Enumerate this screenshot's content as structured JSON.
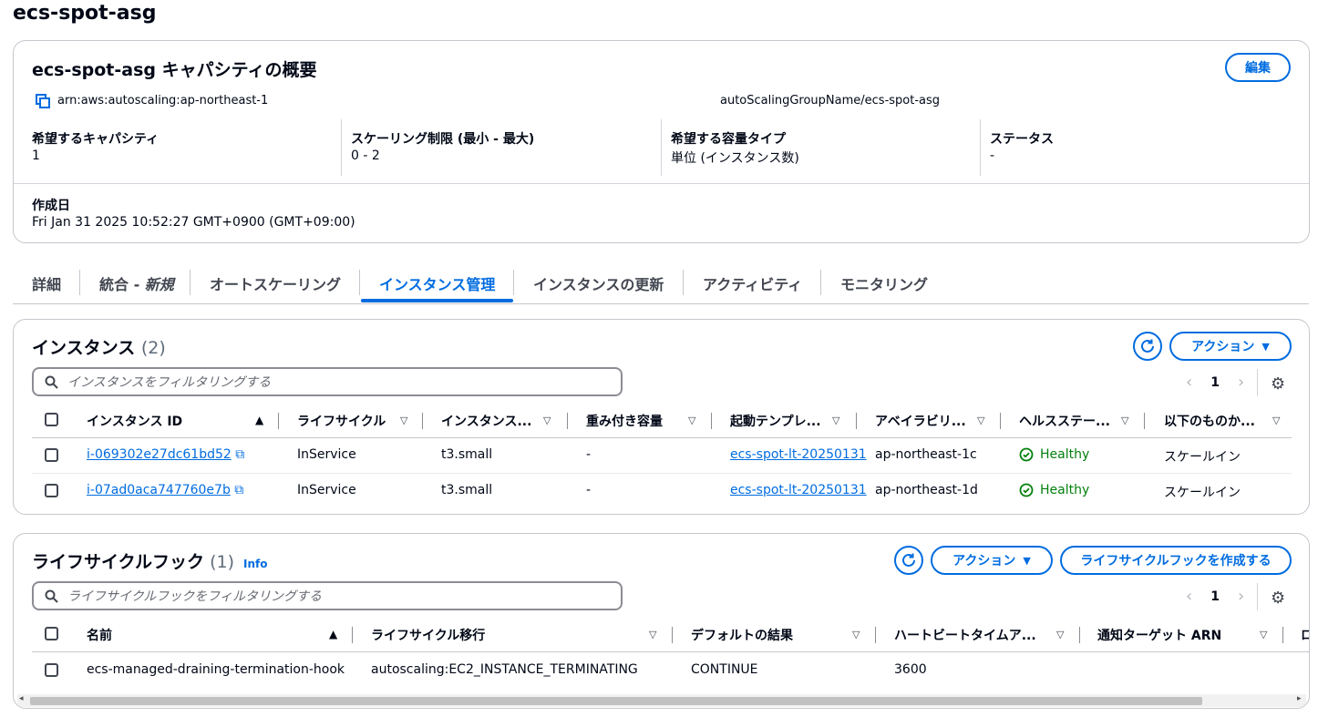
{
  "page": {
    "title": "ecs-spot-asg"
  },
  "summary": {
    "title": "ecs-spot-asg キャパシティの概要",
    "edit_label": "編集",
    "arn_left": "arn:aws:autoscaling:ap-northeast-1",
    "arn_right": "autoScalingGroupName/ecs-spot-asg",
    "fields": [
      {
        "label": "希望するキャパシティ",
        "value": "1"
      },
      {
        "label": "スケーリング制限 (最小 - 最大)",
        "value": "0 - 2"
      },
      {
        "label": "希望する容量タイプ",
        "value": "単位 (インスタンス数)"
      },
      {
        "label": "ステータス",
        "value": "-"
      }
    ],
    "created_label": "作成日",
    "created_value": "Fri Jan 31 2025 10:52:27 GMT+0900 (GMT+09:00)"
  },
  "tabs": [
    {
      "label": "詳細"
    },
    {
      "label": "統合 - ",
      "label_em": "新規"
    },
    {
      "label": "オートスケーリング"
    },
    {
      "label": "インスタンス管理"
    },
    {
      "label": "インスタンスの更新"
    },
    {
      "label": "アクティビティ"
    },
    {
      "label": "モニタリング"
    }
  ],
  "instances": {
    "title": "インスタンス",
    "count": "(2)",
    "actions_label": "アクション",
    "filter_placeholder": "インスタンスをフィルタリングする",
    "page": "1",
    "columns": [
      "インスタンス ID",
      "ライフサイクル",
      "インスタンス...",
      "重み付き容量",
      "起動テンプレ...",
      "アベイラビリ...",
      "ヘルスステー...",
      "以下のものか..."
    ],
    "rows": [
      {
        "id": "i-069302e27dc61bd52",
        "lifecycle": "InService",
        "type": "t3.small",
        "weight": "-",
        "template": "ecs-spot-lt-20250131",
        "az": "ap-northeast-1c",
        "health": "Healthy",
        "protect": "スケールイン"
      },
      {
        "id": "i-07ad0aca747760e7b",
        "lifecycle": "InService",
        "type": "t3.small",
        "weight": "-",
        "template": "ecs-spot-lt-20250131",
        "az": "ap-northeast-1d",
        "health": "Healthy",
        "protect": "スケールイン"
      }
    ]
  },
  "hooks": {
    "title": "ライフサイクルフック",
    "count": "(1)",
    "info_label": "Info",
    "actions_label": "アクション",
    "create_label": "ライフサイクルフックを作成する",
    "filter_placeholder": "ライフサイクルフックをフィルタリングする",
    "page": "1",
    "columns": [
      "名前",
      "ライフサイクル移行",
      "デフォルトの結果",
      "ハートビートタイムア...",
      "通知ターゲット ARN",
      "ロ"
    ],
    "rows": [
      {
        "name": "ecs-managed-draining-termination-hook",
        "transition": "autoscaling:EC2_INSTANCE_TERMINATING",
        "default": "CONTINUE",
        "heartbeat": "3600"
      }
    ]
  },
  "colors": {
    "accent": "#006ce0",
    "healthy": "#037f0c",
    "text": "#000716"
  }
}
